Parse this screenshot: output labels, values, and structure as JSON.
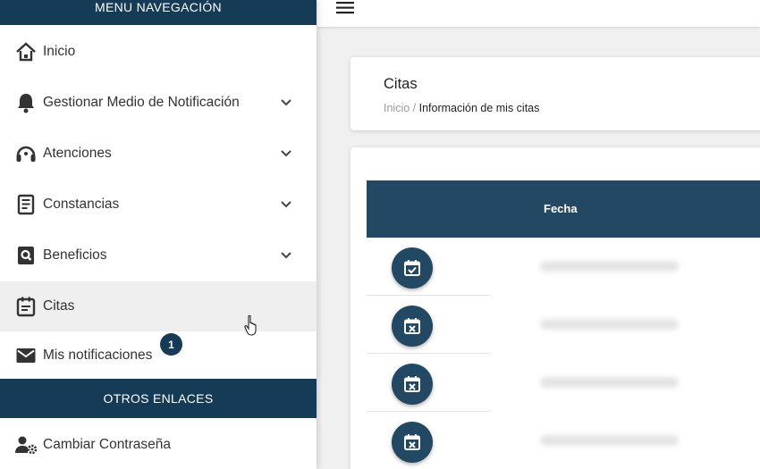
{
  "sidebar": {
    "nav_header": "MENU NAVEGACIÓN",
    "items": [
      {
        "label": "Inicio",
        "icon": "home-icon",
        "expandable": false
      },
      {
        "label": "Gestionar Medio de Notificación",
        "icon": "bell-icon",
        "expandable": true
      },
      {
        "label": "Atenciones",
        "icon": "headset-icon",
        "expandable": true
      },
      {
        "label": "Constancias",
        "icon": "document-icon",
        "expandable": true
      },
      {
        "label": "Beneficios",
        "icon": "search-document-icon",
        "expandable": true
      },
      {
        "label": "Citas",
        "icon": "calendar-icon",
        "expandable": false,
        "active": true
      },
      {
        "label": "Mis notificaciones",
        "icon": "mail-icon",
        "expandable": false,
        "badge": "1"
      }
    ],
    "other_header": "OTROS ENLACES",
    "other_items": [
      {
        "label": "Cambiar Contraseña",
        "icon": "user-gear-icon"
      }
    ]
  },
  "page": {
    "title": "Citas",
    "breadcrumb_home": "Inicio",
    "breadcrumb_sep": " / ",
    "breadcrumb_current": "Información de mis citas"
  },
  "table": {
    "column_fecha": "Fecha",
    "rows": [
      {
        "icon": "calendar-check-icon"
      },
      {
        "icon": "calendar-x-icon"
      },
      {
        "icon": "calendar-x-icon"
      },
      {
        "icon": "calendar-x-icon"
      }
    ]
  },
  "colors": {
    "primary": "#163b56",
    "table_header": "#234863",
    "active_bg": "#efefef"
  }
}
